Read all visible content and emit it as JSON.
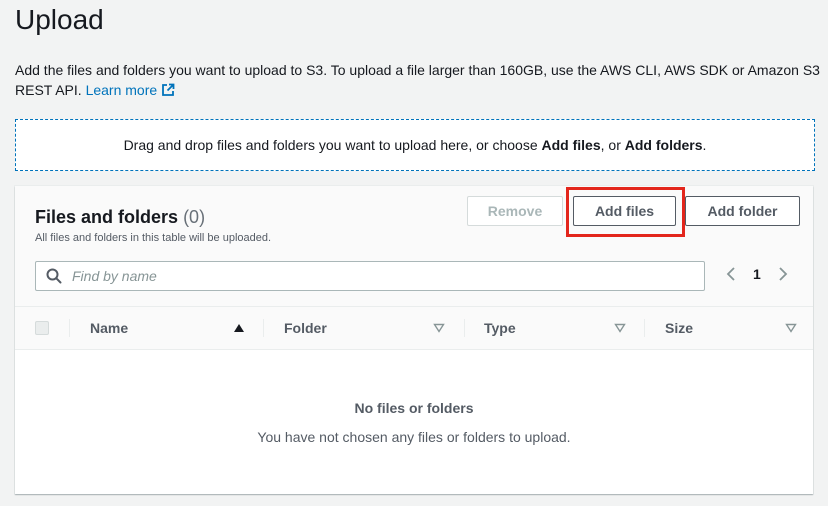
{
  "page": {
    "title": "Upload",
    "description": "Add the files and folders you want to upload to S3. To upload a file larger than 160GB, use the AWS CLI, AWS SDK or Amazon S3 REST API.",
    "learn_more": "Learn more"
  },
  "dropzone": {
    "text_before": "Drag and drop files and folders you want to upload here, or choose ",
    "add_files": "Add files",
    "text_middle": ", or ",
    "add_folders": "Add folders",
    "text_after": "."
  },
  "panel": {
    "title": "Files and folders",
    "count": "(0)",
    "subtitle": "All files and folders in this table will be uploaded.",
    "remove_label": "Remove",
    "add_files_label": "Add files",
    "add_folder_label": "Add folder"
  },
  "search": {
    "placeholder": "Find by name",
    "value": ""
  },
  "pagination": {
    "current_page": "1"
  },
  "table": {
    "columns": [
      "Name",
      "Folder",
      "Type",
      "Size"
    ],
    "empty_title": "No files or folders",
    "empty_description": "You have not chosen any files or folders to upload."
  },
  "icons": {
    "external": "external-link-icon",
    "search": "search-icon",
    "prev": "chevron-left-icon",
    "next": "chevron-right-icon",
    "sort_asc": "sort-ascending-icon",
    "sort_none": "sort-descending-icon"
  },
  "colors": {
    "link": "#0073bb",
    "highlight": "#e3261c",
    "background": "#f2f3f3"
  }
}
